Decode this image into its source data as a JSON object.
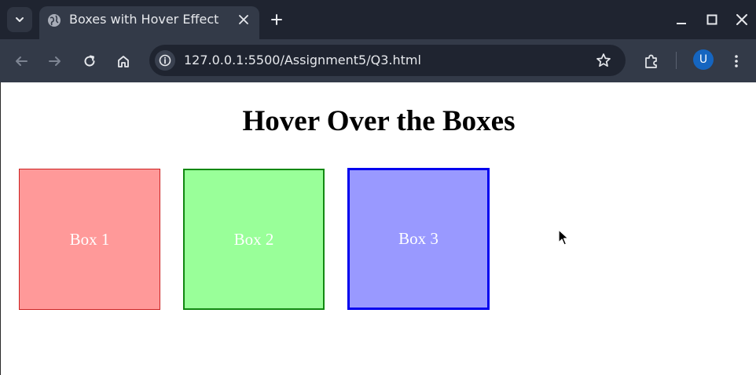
{
  "browser": {
    "tab_title": "Boxes with Hover Effect",
    "url": "127.0.0.1:5500/Assignment5/Q3.html",
    "profile_initial": "U"
  },
  "icons": {
    "tab_search": "chevron-down-icon",
    "favicon": "globe-icon",
    "tab_close": "close-icon",
    "new_tab": "plus-icon",
    "back": "arrow-left-icon",
    "forward": "arrow-right-icon",
    "reload": "reload-icon",
    "home": "home-icon",
    "site_info": "info-icon",
    "bookmark": "star-icon",
    "extensions": "puzzle-icon",
    "menu": "kebab-menu-icon"
  },
  "page": {
    "title": "Hover Over the Boxes",
    "boxes": [
      {
        "label": "Box 1",
        "color": "#ff9999",
        "border": "#cc2222"
      },
      {
        "label": "Box 2",
        "color": "#99ff99",
        "border": "#118811"
      },
      {
        "label": "Box 3",
        "color": "#9999ff",
        "border": "#0000ee"
      }
    ]
  },
  "colors": {
    "chrome_dark": "#1f2430",
    "chrome_toolbar": "#333a48",
    "avatar": "#1565c0"
  }
}
